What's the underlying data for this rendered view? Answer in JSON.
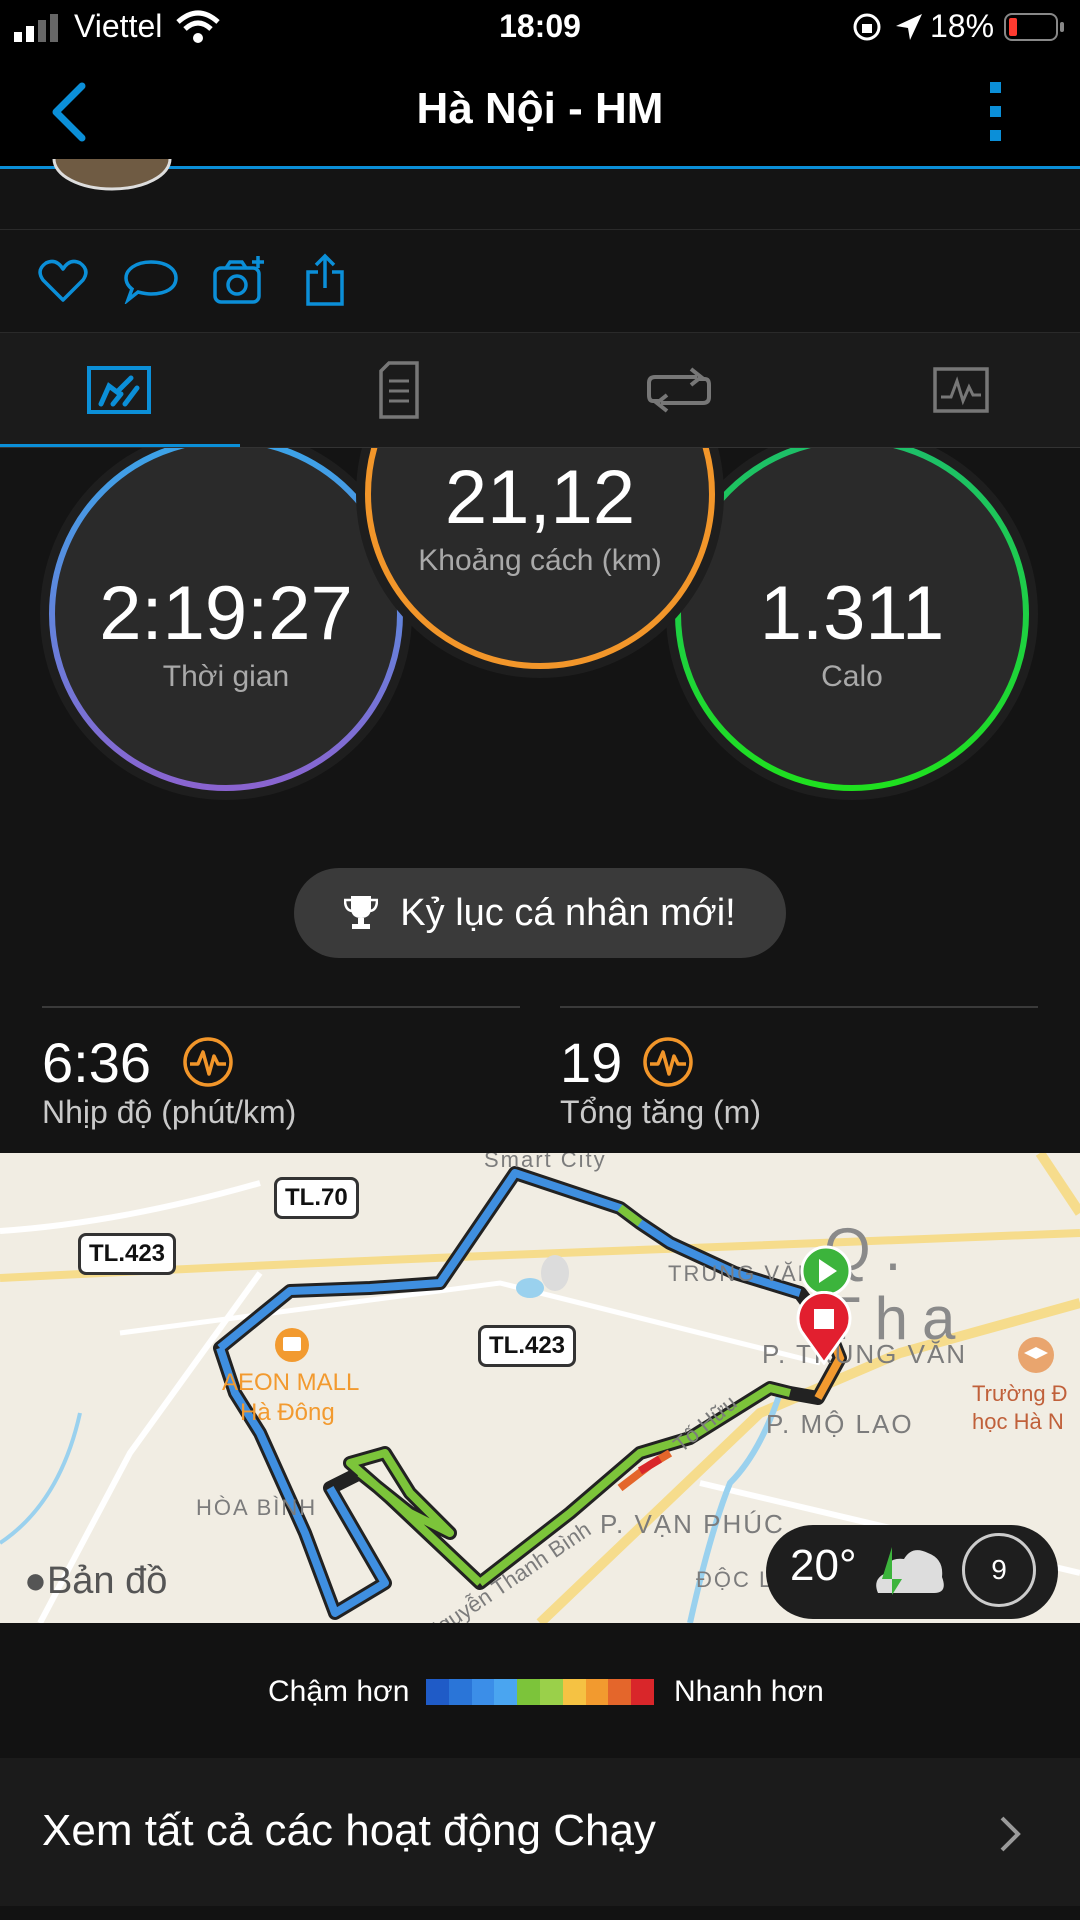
{
  "status_bar": {
    "carrier": "Viettel",
    "time": "18:09",
    "battery_percent": "18%"
  },
  "nav": {
    "title": "Hà Nội - HM"
  },
  "tabs": [
    {
      "name": "overview",
      "icon": "summary-chart-icon",
      "active": true
    },
    {
      "name": "stats",
      "icon": "document-icon",
      "active": false
    },
    {
      "name": "laps",
      "icon": "laps-icon",
      "active": false
    },
    {
      "name": "charts",
      "icon": "chart-icon",
      "active": false
    }
  ],
  "stats": {
    "time": {
      "value": "2:19:27",
      "label": "Thời gian"
    },
    "distance": {
      "value": "21,12",
      "label": "Khoảng cách (km)"
    },
    "calories": {
      "value": "1.311",
      "label": "Calo"
    }
  },
  "personal_record": {
    "text": "Kỷ lục cá nhân mới!"
  },
  "metrics": {
    "pace": {
      "value": "6:36",
      "label": "Nhịp độ (phút/km)"
    },
    "elevation": {
      "value": "19",
      "label": "Tổng tăng (m)"
    }
  },
  "map": {
    "labels": [
      "Smart City",
      "TRUNG VĂN",
      "P. TRUNG VĂN",
      "Q. Tha",
      "AEON MALL",
      "Hà Đông",
      "HÒA BÌNH",
      "P. MỘ LAO",
      "P. VẠN PHÚC",
      "Tố Hữu",
      "Nguyễn Thanh Bình",
      "Trường Đ",
      "học Hà N",
      "ĐỘC L"
    ],
    "road_badges": [
      "TL.70",
      "TL.423",
      "TL.423"
    ],
    "brand": "Bản đồ",
    "weather": {
      "temperature": "20°",
      "wind": "9"
    }
  },
  "legend": {
    "slow_label": "Chậm hơn",
    "fast_label": "Nhanh hơn",
    "colors": [
      "#1f5bc7",
      "#2a75d8",
      "#3b8ee8",
      "#4aa5f0",
      "#7cc43a",
      "#9ad04a",
      "#f5c243",
      "#f29a2f",
      "#e4662b",
      "#d9262a"
    ]
  },
  "footer": {
    "see_all_label": "Xem tất cả các hoạt động Chạy"
  }
}
